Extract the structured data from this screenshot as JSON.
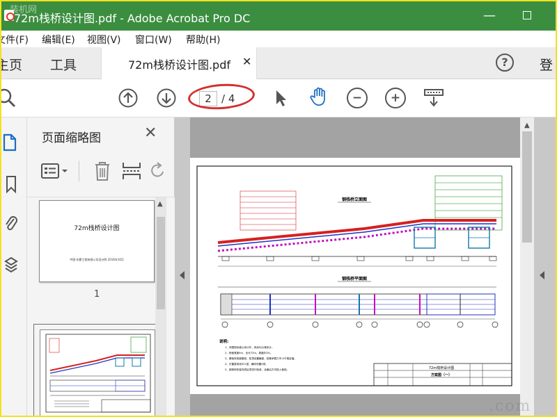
{
  "window": {
    "title": "72m栈桥设计图.pdf - Adobe Acrobat Pro DC",
    "watermark_top": "装机网",
    "minimize_glyph": "—",
    "watermark_bottom": ".com"
  },
  "menu": [
    "文件(F)",
    "编辑(E)",
    "视图(V)",
    "窗口(W)",
    "帮助(H)"
  ],
  "tabs": {
    "home": "主页",
    "tools": "工具",
    "document": "72m栈桥设计图.pdf",
    "close_glyph": "✕",
    "help_glyph": "?",
    "login": "登"
  },
  "toolbar": {
    "current_page": "2",
    "total_pages": "/ 4",
    "zoom_out_glyph": "−",
    "zoom_in_glyph": "+"
  },
  "thumbnails": {
    "title": "页面缩略图",
    "close_glyph": "✕",
    "page1_title": "72m栈桥设计图",
    "page1_subtitle": "中国·东郡工程有限公司设计院  2016年10月",
    "page1_number": "1"
  },
  "drawing": {
    "elevation_title": "钢栈桥立面图",
    "plan_title": "钢栈桥平面图",
    "notes_title": "说明:",
    "notes": [
      "1、本图除标高以米计外，其余均以毫米计。",
      "2、桥面宽度4m，全长72m，坡度约3%。",
      "3、基础采用钢管桩，桩顶设置横梁，桩基承载力不小于规定值。",
      "4、贝雷梁采用321型，横向布置4排。",
      "5、钢栈桥安装完成后须进行验收，合格后方可投入使用。"
    ],
    "title_block_title": "72m栈桥设计图",
    "title_block_sheet": "方案图（一）",
    "colors": {
      "line": "#333333",
      "red": "#d62020",
      "green": "#0a8a0a",
      "blue": "#2030c0",
      "magenta": "#c010c0"
    }
  }
}
